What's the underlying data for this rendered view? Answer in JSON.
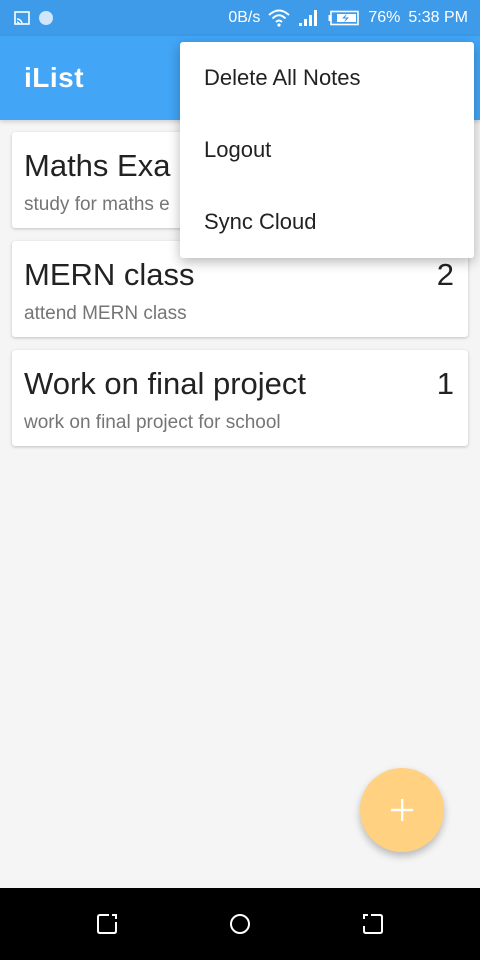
{
  "status_bar": {
    "speed": "0B/s",
    "battery": "76%",
    "time": "5:38 PM"
  },
  "app": {
    "title": "iList"
  },
  "notes": [
    {
      "title": "Maths Exa",
      "subtitle": "study for maths e",
      "count": ""
    },
    {
      "title": "MERN class",
      "subtitle": "attend MERN class",
      "count": "2"
    },
    {
      "title": "Work on final project",
      "subtitle": "work on final project for school",
      "count": "1"
    }
  ],
  "menu": {
    "items": [
      "Delete All Notes",
      "Logout",
      "Sync Cloud"
    ]
  },
  "fab": {
    "icon": "plus-icon",
    "color": "#ffd180"
  },
  "colors": {
    "app_bar": "#42a5f5",
    "status_bar": "#3d9be9"
  }
}
